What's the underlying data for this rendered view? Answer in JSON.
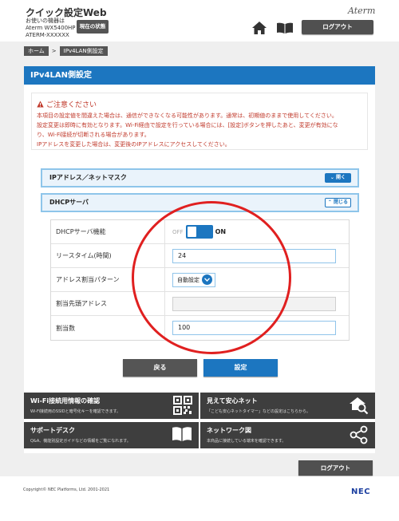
{
  "header": {
    "app_title": "クイック設定Web",
    "device_line1": "お使いの機器は",
    "device_line2": "Aterm WX5400HP",
    "device_line3": "ATERM-XXXXXX",
    "status_button": "現在の状態",
    "brand": "Aterm",
    "home_icon": "home-icon",
    "manual_icon": "book-icon",
    "logout_button": "ログアウト"
  },
  "breadcrumb": {
    "home": "ホーム",
    "separator": ">",
    "current": "IPv4LAN側設定"
  },
  "page_title": "IPv4LAN側設定",
  "warning": {
    "title": "ご注意ください",
    "line1": "本項目の設定値を間違えた場合は、通信ができなくなる可能性があります。通常は、初期値のままで使用してください。",
    "line2": "設定変更は即時に有効となります。Wi-Fi経由で設定を行っている場合には、[設定]ボタンを押したあと、変更が有効にな",
    "line3": "り、Wi-Fi接続が切断される場合があります。",
    "line4": "IPアドレスを変更した場合は、変更後のIPアドレスにアクセスしてください。"
  },
  "sections": {
    "ip_mask": {
      "label": "IPアドレス／ネットマスク",
      "button": "開く"
    },
    "dhcp": {
      "label": "DHCPサーバ",
      "button": "閉じる"
    }
  },
  "dhcp_fields": {
    "dhcp_function": {
      "label": "DHCPサーバ機能",
      "off": "OFF",
      "on": "ON"
    },
    "lease_time": {
      "label": "リースタイム(時間)",
      "value": "24"
    },
    "allocation_pattern": {
      "label": "アドレス割当パターン",
      "value": "自動設定"
    },
    "start_address": {
      "label": "割当先頭アドレス",
      "value": ""
    },
    "allocation_count": {
      "label": "割当数",
      "value": "100"
    }
  },
  "actions": {
    "back": "戻る",
    "save": "設定"
  },
  "tiles": [
    {
      "title": "Wi-Fi接続用情報の確認",
      "desc": "Wi-Fi接続用のSSIDと暗号化キーを確認できます。",
      "icon": "qr-code-icon"
    },
    {
      "title": "見えて安心ネット",
      "desc": "「こども安心ネットタイマー」などの設定はこちらから。",
      "icon": "house-search-icon"
    },
    {
      "title": "サポートデスク",
      "desc": "Q&A、機能別設定ガイドなどの情報をご覧になれます。",
      "icon": "book-open-icon"
    },
    {
      "title": "ネットワーク図",
      "desc": "本商品に接続している端末を確認できます。",
      "icon": "share-network-icon"
    }
  ],
  "footer": {
    "logout_button": "ログアウト",
    "copyright": "Copyright© NEC Platforms, Ltd. 2001-2021",
    "logo": "NEC"
  },
  "colors": {
    "accent": "#1c76c0",
    "warning": "#c0392b",
    "annotation_circle": "#e02020"
  }
}
